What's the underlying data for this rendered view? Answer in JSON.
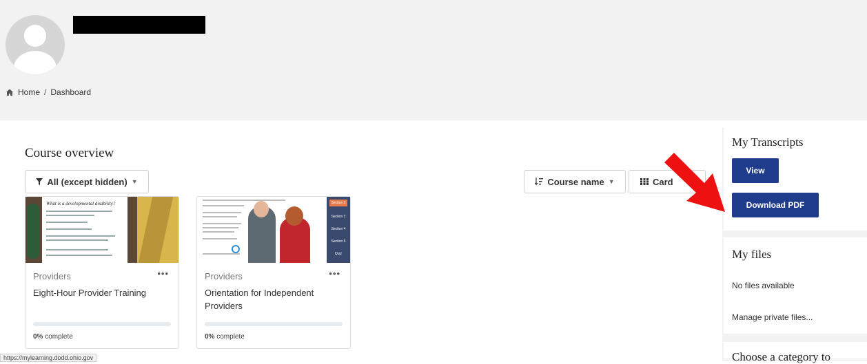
{
  "breadcrumb": {
    "home": "Home",
    "separator": "/",
    "current": "Dashboard"
  },
  "course_overview": {
    "title": "Course overview",
    "filter_label": "All (except hidden)",
    "sort_label": "Course name",
    "view_label": "Card"
  },
  "courses": [
    {
      "category": "Providers",
      "title": "Eight-Hour Provider Training",
      "progress_percent": "0%",
      "progress_suffix": "complete",
      "image_heading": "What is a developmental disability?"
    },
    {
      "category": "Providers",
      "title": "Orientation for Independent Providers",
      "progress_percent": "0%",
      "progress_suffix": "complete",
      "side_tags": [
        "Section 2",
        "Section 3",
        "Section 4",
        "Section 5",
        "Quiz"
      ]
    }
  ],
  "status_url": "https://mylearning.dodd.ohio.gov",
  "transcripts": {
    "title": "My Transcripts",
    "view_label": "View",
    "download_label": "Download PDF"
  },
  "files": {
    "title": "My files",
    "empty_text": "No files available",
    "manage_link": "Manage private files..."
  },
  "category_block": {
    "title": "Choose a category to"
  },
  "colors": {
    "primary_button": "#1f3b8c",
    "arrow": "#ee1111",
    "page_bg": "#f2f2f2"
  },
  "icons": {
    "home": "home-icon",
    "filter": "filter-icon",
    "sort": "sort-icon",
    "view": "grid-icon",
    "more": "more-icon"
  }
}
